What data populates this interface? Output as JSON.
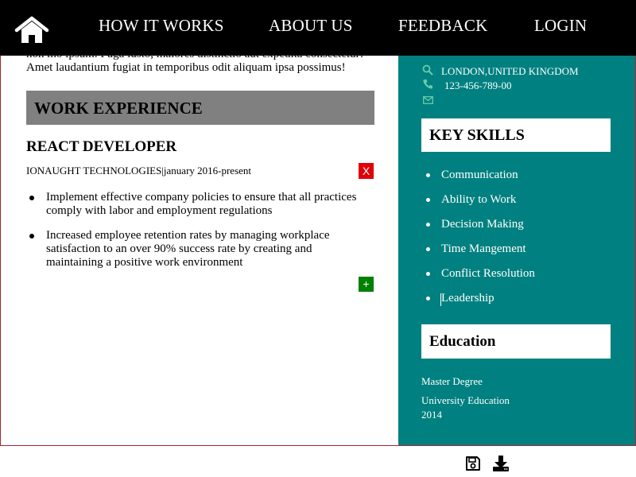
{
  "nav": {
    "links": [
      "HOW IT WORKS",
      "ABOUT US",
      "FEEDBACK",
      "LOGIN"
    ],
    "home_icon": "home-icon"
  },
  "resume": {
    "intro_lines": [
      "non mo ipsum. Fuga iusto, maiores distinctio aut expedita consectetur!",
      "Amet laudantium fugiat in temporibus odit aliquam ipsa possimus!"
    ],
    "work_heading": "WORK EXPERIENCE",
    "job": {
      "title": "REACT DEVELOPER",
      "meta": "IONAUGHT TECHNOLOGIES|january 2016-present",
      "delete_label": "X",
      "bullets": [
        "Implement effective company policies to ensure that all practices comply with labor and employment regulations",
        "Increased employee retention rates by managing workplace satisfaction to an over 90% success rate by creating and maintaining a positive work environment"
      ]
    },
    "add_label": "+",
    "contact": {
      "location": "LONDON,UNITED KINGDOM",
      "phone": "123-456-789-00",
      "email": ""
    },
    "skills_heading": "KEY SKILLS",
    "skills": [
      "Communication",
      "Ability to Work",
      "Decision Making",
      "Time Mangement",
      "Conflict Resolution",
      "Leadership"
    ],
    "education_heading": "Education",
    "education": {
      "degree": "Master Degree",
      "school": "University Education",
      "year": "2014"
    }
  },
  "toolbar": {
    "save_icon": "save-icon",
    "download_icon": "download-icon"
  },
  "colors": {
    "nav_bg": "#000000",
    "sidebar_bg": "#008080",
    "section_header_bg": "#808080",
    "delete_btn": "#e0000a",
    "add_btn": "#008000",
    "contact_icon": "#66ccaa",
    "frame_border": "#a0282c"
  }
}
